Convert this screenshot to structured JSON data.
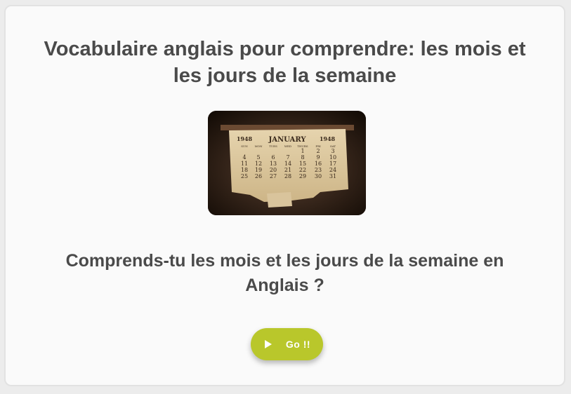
{
  "title": "Vocabulaire anglais pour comprendre: les mois et les jours de la semaine",
  "cover_image": {
    "icon": "calendar-photo",
    "calendar_month": "JANUARY",
    "calendar_year": "1948",
    "weekday_headers": [
      "SUN",
      "MON",
      "TUES",
      "WED",
      "THURS",
      "FRI",
      "SAT"
    ],
    "rows": [
      [
        "",
        "",
        "",
        "",
        "1",
        "2",
        "3"
      ],
      [
        "4",
        "5",
        "6",
        "7",
        "8",
        "9",
        "10"
      ],
      [
        "11",
        "12",
        "13",
        "14",
        "15",
        "16",
        "17"
      ],
      [
        "18",
        "19",
        "20",
        "21",
        "22",
        "23",
        "24"
      ],
      [
        "25",
        "26",
        "27",
        "28",
        "29",
        "30",
        "31"
      ]
    ]
  },
  "question": "Comprends-tu les mois et les jours de la semaine en Anglais ?",
  "go_button": {
    "label": "Go !!",
    "icon": "play-icon",
    "color": "#b9c72b"
  },
  "colors": {
    "text": "#4a4a4a",
    "card_background": "#fafafa"
  }
}
